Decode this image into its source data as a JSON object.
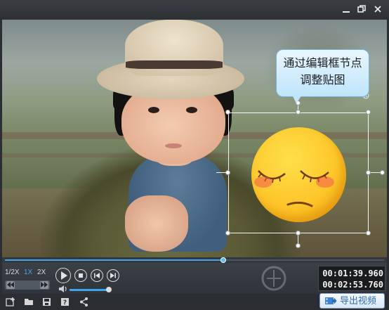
{
  "window": {
    "buttons": [
      {
        "name": "minimize-button",
        "icon": "minimize-icon"
      },
      {
        "name": "restore-button",
        "icon": "restore-icon"
      },
      {
        "name": "close-button",
        "icon": "close-icon"
      }
    ]
  },
  "tooltip": {
    "line1": "通过编辑框节点",
    "line2": "调整贴图"
  },
  "playback": {
    "progress": 0.575,
    "speeds": [
      "1/2X",
      "1X",
      "2X"
    ],
    "active_speed": "1X",
    "volume": 1.0,
    "current_time": "00:01:39.960",
    "total_time": "00:02:53.760"
  },
  "toolbar": {
    "icons": [
      "add-icon",
      "folder-open-icon",
      "save-icon",
      "help-icon",
      "share-icon"
    ],
    "export_label": "导出视频"
  },
  "colors": {
    "accent": "#3ea4ec",
    "tooltip_border": "#6fb5de",
    "export_text": "#2d6fb3"
  }
}
